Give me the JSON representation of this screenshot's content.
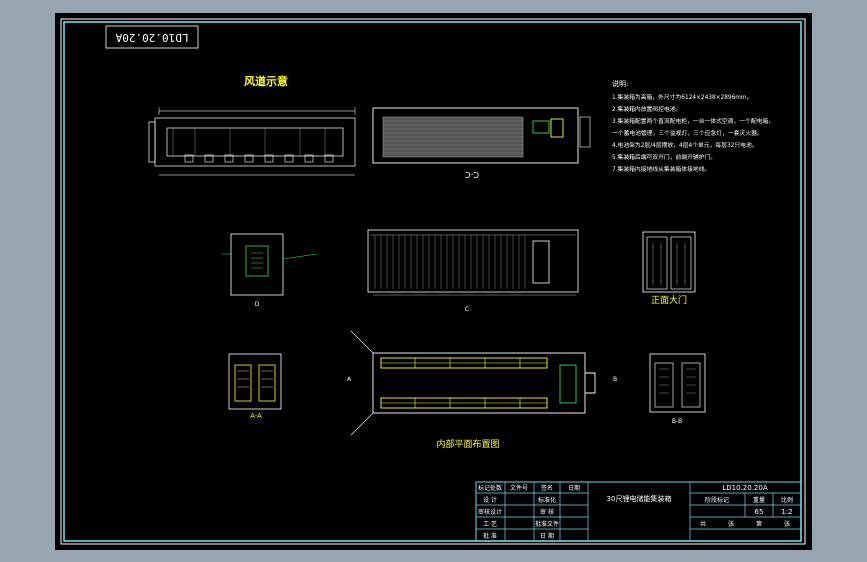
{
  "drawing": {
    "code_rotated": "LD10.20.20A",
    "duct_title": "风道示意",
    "section_cc": "C-C",
    "section_aa": "A-A",
    "section_bb": "B-B",
    "front_door_title": "正面大门",
    "layout_title": "内部平面布置图",
    "markers": [
      "A",
      "A",
      "B",
      "B",
      "C",
      "C",
      "D",
      "D"
    ]
  },
  "notes": {
    "heading": "说明:",
    "items": [
      "1.集装箱为高箱，外尺寸为6124×2438×2896mm。",
      "2.集装箱内放置阀控电池。",
      "3.集装箱配置两个直流配电柜，一台一体式空调，一个配电箱，",
      "一个蓄电池管理，三个监视灯，三个应急灯，一套灭火器。",
      "4.电池架为2层/4层摆放，4层4个单元，每层32只电池。",
      "5.集装箱后端可双开门，前端开辅护门。",
      "7.集装箱内接地线从集装箱体接地线。"
    ]
  },
  "title_block": {
    "drawing_no": "LD10.20.20A",
    "title": "30尺锂电储能集装箱",
    "rows": [
      [
        "标记处数",
        "文件号",
        "签名",
        "日期"
      ],
      [
        "设 计",
        "",
        "标准化",
        ""
      ],
      [
        "审核设计",
        "",
        "审 核",
        ""
      ],
      [
        "工 艺",
        "",
        "批准文件",
        ""
      ],
      [
        "批 准",
        "",
        "日 期",
        ""
      ]
    ],
    "stage_header": [
      "阶段标记",
      "重量",
      "比例"
    ],
    "weight": "65",
    "scale": "1:2",
    "sheet": [
      "共",
      "张",
      "第",
      "张"
    ]
  }
}
